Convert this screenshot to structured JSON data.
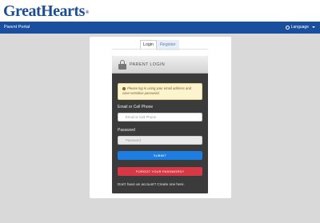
{
  "brand": {
    "logo_text": "GreatHearts",
    "trademark": "®"
  },
  "navbar": {
    "title": "Parent Portal",
    "language_label": "Language"
  },
  "tabs": [
    {
      "label": "Login"
    },
    {
      "label": "Register"
    }
  ],
  "login_card": {
    "title": "PARENT LOGIN",
    "alert_text": "Please log in using your email address and case-sensitive password.",
    "email_label": "Email or Cell Phone",
    "email_placeholder": "Email or Cell Phone",
    "password_label": "Password",
    "password_placeholder": "Password",
    "submit_label": "SUBMIT",
    "forgot_label": "FORGOT YOUR PASSWORD?",
    "signup_text": "Don't have an account? Create one here."
  }
}
